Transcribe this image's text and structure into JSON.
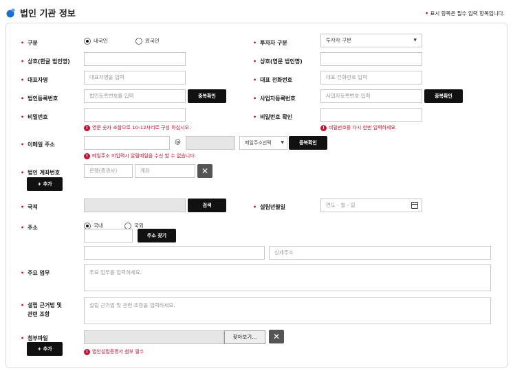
{
  "header": {
    "title": "법인 기관 정보",
    "required_note": "표시 항목은 필수 입력 항목입니다."
  },
  "form": {
    "type_label": "구분",
    "type_options": [
      "내국인",
      "외국인"
    ],
    "investor_type_label": "투자자 구분",
    "investor_type_value": "투자자 구분",
    "name_kr_label": "상호(한글 법인명)",
    "name_en_label": "상호(영문 법인명)",
    "ceo_label": "대표자명",
    "ceo_placeholder": "대표자명을 입력",
    "phone_label": "대표 전화번호",
    "phone_placeholder": "대표 전화번호 입력",
    "corp_reg_label": "법인등록번호",
    "corp_reg_placeholder": "법인등록번호를 입력",
    "biz_reg_label": "사업자등록번호",
    "biz_reg_placeholder": "사업자등록번호 입력",
    "dup_check": "중복확인",
    "password_label": "비밀번호",
    "password_error": "영문 숫자 조합으로 10-12자리로 구성 하십시오.",
    "password_confirm_label": "비밀번호 확인",
    "password_confirm_error": "비밀번호를 다시 한번 입력하세요.",
    "email_label": "이메일 주소",
    "email_at": "@",
    "email_select": "메일주소선택",
    "email_error": "메일주소 미입력시 알림메일을 수신 할 수 없습니다.",
    "account_label": "법인 계좌번호",
    "bank_placeholder": "은행(증권사)",
    "account_placeholder": "계좌",
    "add_label": "+ 추가",
    "country_label": "국적",
    "search_label": "검색",
    "founded_label": "설립년월일",
    "date_placeholder": "연도 - 월 - 일",
    "address_label": "주소",
    "address_options": [
      "국내",
      "국외"
    ],
    "address_search": "주소 찾기",
    "address_detail_placeholder": "상세주소",
    "business_label": "주요 업무",
    "business_placeholder": "주요 업무를 입력하세요.",
    "law_label_line1": "설립 근거법 및",
    "law_label_line2": "관련 조항",
    "law_placeholder": "설립 근거법 및 관련 조항을 입력하세요.",
    "attach_label": "첨부파일",
    "browse_label": "찾아보기...",
    "attach_error": "법인설립증명서 첨부 필수"
  },
  "icons": {
    "title": "blue-dot-icon",
    "close": "close-icon",
    "calendar": "calendar-icon",
    "error": "error-icon",
    "caret": "caret-down-icon"
  },
  "colors": {
    "accent_blue": "#1a6fd0",
    "required_red": "#c8102e",
    "button_black": "#111111"
  }
}
